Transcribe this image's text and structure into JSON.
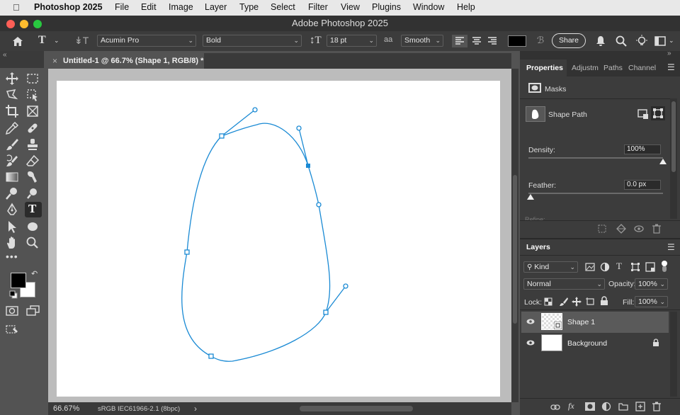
{
  "menubar": {
    "apple": "",
    "app_name": "Photoshop 2025",
    "items": [
      "File",
      "Edit",
      "Image",
      "Layer",
      "Type",
      "Select",
      "Filter",
      "View",
      "Plugins",
      "Window",
      "Help"
    ]
  },
  "window": {
    "title": "Adobe Photoshop 2025"
  },
  "options": {
    "font_family": "Acumin Pro",
    "font_style": "Bold",
    "font_size": "18 pt",
    "antialias_icon": "aa",
    "antialias": "Smooth",
    "share_label": "Share",
    "text_color": "#000000"
  },
  "document": {
    "tab_title": "Untitled-1 @ 66.7% (Shape 1, RGB/8) *",
    "close": "×"
  },
  "status": {
    "zoom": "66.67%",
    "profile": "sRGB IEC61966-2.1 (8bpc)",
    "arrow": "›"
  },
  "properties": {
    "tabs": [
      "Properties",
      "Adjustm",
      "Paths",
      "Channel"
    ],
    "section": "Masks",
    "shape_path": "Shape Path",
    "density_label": "Density:",
    "density_value": "100%",
    "density_level": 1.0,
    "feather_label": "Feather:",
    "feather_value": "0.0 px",
    "feather_level": 0.0,
    "refine_label": "Refine:"
  },
  "layers": {
    "title": "Layers",
    "filter_kind": "Kind",
    "blend_mode": "Normal",
    "opacity_label": "Opacity:",
    "opacity_value": "100%",
    "lock_label": "Lock:",
    "fill_label": "Fill:",
    "fill_value": "100%",
    "items": [
      {
        "name": "Shape 1",
        "selected": true,
        "locked": false
      },
      {
        "name": "Background",
        "selected": false,
        "locked": true
      }
    ]
  },
  "colors": {
    "foreground": "#000000",
    "background": "#ffffff",
    "path_stroke": "#1a8ad4",
    "accent": "#1473e6"
  }
}
